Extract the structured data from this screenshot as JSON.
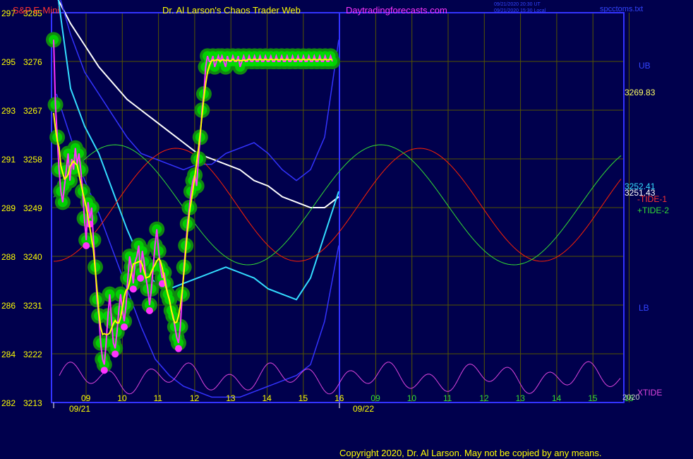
{
  "header": {
    "symbol": "S&P E-Mini",
    "title": "Dr. Al Larson's Chaos Trader Web",
    "site": "Daytradingforecasts.com",
    "stamp1": "09/21/2020 20:30 UT",
    "stamp2": "09/21/2020 15:30 Local",
    "file": "spcctoms.txt"
  },
  "copyright": "Copyright 2020, Dr. Al Larson. May not be copied by any means.",
  "colors": {
    "background": "#00004d",
    "price": "#ff33ff",
    "price_halo": "#00dd00",
    "moving_average": "#ffff00",
    "white_line": "#ffffff",
    "cyan_line": "#33ddff",
    "blue_band": "#3333ff",
    "tide1": "#ff2200",
    "tide2": "#33dd33",
    "xtide": "#dd44dd",
    "grid": "#555500"
  },
  "chart_data": {
    "type": "line",
    "x_axis": {
      "ticks": [
        "09",
        "10",
        "11",
        "12",
        "13",
        "14",
        "15",
        "16",
        "09",
        "10",
        "11",
        "12",
        "13",
        "14",
        "15",
        "16"
      ],
      "tick_colors": [
        "yellow",
        "yellow",
        "yellow",
        "yellow",
        "yellow",
        "yellow",
        "yellow",
        "yellow",
        "green",
        "green",
        "green",
        "green",
        "green",
        "green",
        "green",
        "green"
      ],
      "dates": [
        "09/21",
        "09/22"
      ],
      "year": "2020"
    },
    "y_axis_left_inner": {
      "ticks": [
        3285,
        3276,
        3267,
        3258,
        3249,
        3240,
        3231,
        3222,
        3213
      ],
      "range": [
        3213,
        3285
      ]
    },
    "y_axis_left_outer": {
      "ticks": [
        297,
        295,
        293,
        291,
        289,
        288,
        286,
        284,
        282
      ]
    },
    "right_labels": {
      "ub": "UB",
      "lb": "LB",
      "value_top": "3269.83",
      "value_cyan": "3252.41",
      "value_white": "3251.43",
      "tide1": "-TIDE-1",
      "tide2": "+TIDE-2",
      "xtide": "XTIDE"
    },
    "series": {
      "price": {
        "x": [
          0,
          0.05,
          0.1,
          0.15,
          0.2,
          0.25,
          0.3,
          0.35,
          0.4,
          0.45,
          0.5,
          0.55,
          0.6,
          0.65,
          0.7,
          0.75,
          0.8,
          0.85,
          0.9,
          0.95,
          1.0,
          1.05,
          1.1,
          1.15,
          1.2,
          1.25,
          1.3,
          1.35,
          1.4,
          1.45,
          1.5,
          1.55,
          1.6,
          1.65,
          1.7,
          1.75,
          1.8,
          1.85,
          1.9,
          1.95,
          2.0,
          2.05,
          2.1,
          2.15,
          2.2,
          2.25,
          2.3,
          2.35,
          2.4,
          2.45,
          2.5,
          2.55,
          2.6,
          2.65,
          2.7,
          2.75,
          2.8,
          2.85,
          2.9,
          2.95,
          3.0,
          3.05,
          3.1,
          3.15,
          3.2,
          3.25,
          3.3,
          3.35,
          3.4,
          3.45,
          3.5,
          3.55,
          3.6,
          3.65,
          3.7,
          3.75,
          3.8,
          3.85,
          3.9,
          3.95,
          4.0,
          4.05,
          4.1,
          4.15,
          4.2,
          4.25,
          4.3,
          4.35,
          4.4,
          4.45,
          4.5,
          4.55,
          4.6,
          4.65,
          4.7,
          4.75,
          4.8,
          4.85,
          4.9,
          4.95,
          5.0,
          5.05,
          5.1,
          5.15,
          5.2,
          5.25,
          5.3,
          5.35,
          5.4,
          5.45,
          5.5,
          5.55,
          5.6,
          5.65,
          5.7,
          5.75,
          5.8,
          5.85,
          5.9,
          5.95,
          6.0,
          6.05,
          6.1,
          6.15,
          6.2,
          6.25,
          6.3,
          6.35,
          6.4,
          6.45,
          6.5,
          6.55,
          6.6,
          6.65,
          6.7,
          6.75,
          6.8,
          6.85,
          6.9,
          6.95,
          7.0,
          7.05,
          7.1,
          7.15,
          7.2,
          7.25,
          7.3,
          7.35,
          7.4,
          7.45,
          7.5,
          7.55,
          7.6,
          7.65,
          7.7
        ],
        "y": [
          3280,
          3268,
          3262,
          3256,
          3252,
          3250,
          3253,
          3256,
          3259,
          3254,
          3258,
          3256,
          3260,
          3257,
          3259,
          3256,
          3252,
          3247,
          3243,
          3250,
          3247,
          3249,
          3243,
          3238,
          3232,
          3229,
          3224,
          3221,
          3220,
          3224,
          3229,
          3233,
          3228,
          3224,
          3223,
          3226,
          3230,
          3233,
          3230,
          3228,
          3231,
          3236,
          3240,
          3238,
          3235,
          3239,
          3240,
          3242,
          3237,
          3241,
          3239,
          3236,
          3234,
          3231,
          3234,
          3238,
          3242,
          3245,
          3241,
          3238,
          3236,
          3237,
          3235,
          3233,
          3232,
          3230,
          3229,
          3227,
          3225,
          3224,
          3227,
          3233,
          3238,
          3242,
          3246,
          3249,
          3252,
          3254,
          3255,
          3253,
          3258,
          3262,
          3267,
          3270,
          3275,
          3277,
          3276,
          3276,
          3277,
          3275,
          3276,
          3277,
          3276,
          3277,
          3276,
          3275,
          3277,
          3276,
          3276,
          3277,
          3276,
          3276,
          3277,
          3275,
          3276,
          3277,
          3276,
          3276,
          3277,
          3276,
          3276,
          3277,
          3276,
          3276,
          3277,
          3276,
          3276,
          3277,
          3276,
          3276,
          3277,
          3276,
          3276,
          3277,
          3276,
          3276,
          3277,
          3276,
          3276,
          3277,
          3276,
          3276,
          3277,
          3276,
          3276,
          3277,
          3276,
          3276,
          3277,
          3276,
          3276,
          3277,
          3276,
          3276,
          3277,
          3276,
          3276,
          3277,
          3276,
          3276,
          3277,
          3276,
          3276,
          3277,
          3276,
          3276,
          3277
        ]
      }
    }
  }
}
